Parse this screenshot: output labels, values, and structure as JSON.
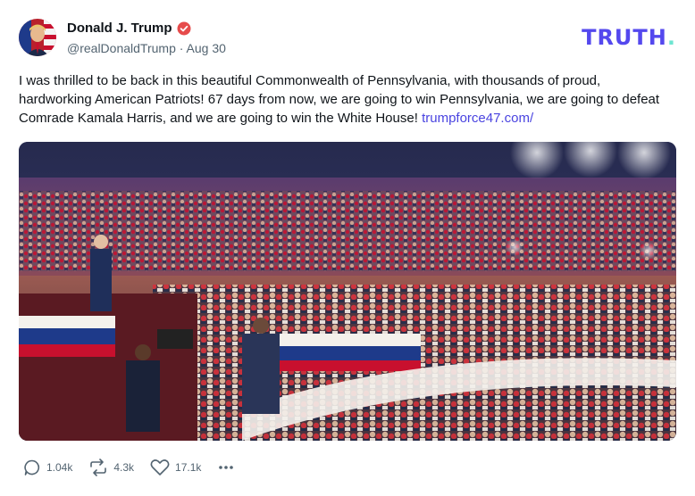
{
  "author": {
    "display_name": "Donald J. Trump",
    "handle": "@realDonaldTrump",
    "separator": "·",
    "date": "Aug 30"
  },
  "brand": {
    "logo_text": "TRUTH",
    "logo_dot": ".",
    "primary": "#5448ee",
    "accent": "#6de5d1"
  },
  "post": {
    "text": "I was thrilled to be back in this beautiful Commonwealth of Pennsylvania, with thousands of proud, hardworking American Patriots! 67 days from now, we are going to win Pennsylvania, we are going to defeat Comrade Kamala Harris, and we are going to win the White House!",
    "link": "trumpforce47.com/",
    "link_color": "#4a44e0"
  },
  "actions": {
    "replies": "1.04k",
    "retruths": "4.3k",
    "likes": "17.1k",
    "more_icon": "ellipsis-icon"
  }
}
